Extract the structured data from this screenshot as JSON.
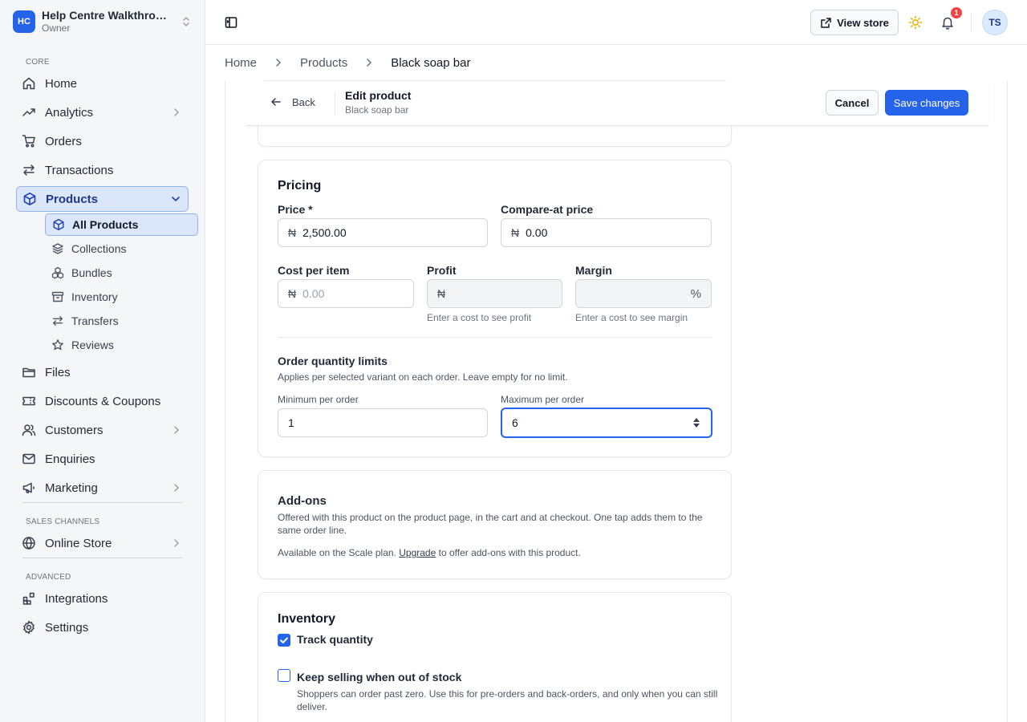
{
  "workspace": {
    "initials": "HC",
    "name": "Help Centre Walkthrough",
    "role": "Owner"
  },
  "sidebar": {
    "core_label": "CORE",
    "home": "Home",
    "analytics": "Analytics",
    "orders": "Orders",
    "transactions": "Transactions",
    "products": "Products",
    "products_sub": {
      "all_products": "All Products",
      "collections": "Collections",
      "bundles": "Bundles",
      "inventory": "Inventory",
      "transfers": "Transfers",
      "reviews": "Reviews"
    },
    "files": "Files",
    "discounts": "Discounts & Coupons",
    "customers": "Customers",
    "enquiries": "Enquiries",
    "marketing": "Marketing",
    "sales_channels_label": "SALES CHANNELS",
    "online_store": "Online Store",
    "advanced_label": "ADVANCED",
    "integrations": "Integrations",
    "settings": "Settings"
  },
  "header": {
    "view_store": "View store",
    "notification_count": "1",
    "user_initials": "TS"
  },
  "breadcrumb": {
    "home": "Home",
    "products": "Products",
    "current": "Black soap bar"
  },
  "editbar": {
    "back": "Back",
    "title": "Edit product",
    "subtitle": "Black soap bar",
    "cancel": "Cancel",
    "save": "Save changes"
  },
  "pricing": {
    "title": "Pricing",
    "currency_symbol": "₦",
    "price_label": "Price *",
    "price_value": "2,500.00",
    "compare_label": "Compare-at price",
    "compare_value": "0.00",
    "cost_label": "Cost per item",
    "cost_placeholder": "0.00",
    "profit_label": "Profit",
    "profit_hint": "Enter a cost to see profit",
    "margin_label": "Margin",
    "margin_unit": "%",
    "margin_hint": "Enter a cost to see margin",
    "limits_title": "Order quantity limits",
    "limits_desc": "Applies per selected variant on each order. Leave empty for no limit.",
    "min_label": "Minimum per order",
    "min_value": "1",
    "max_label": "Maximum per order",
    "max_value": "6"
  },
  "addons": {
    "title": "Add-ons",
    "desc": "Offered with this product on the product page, in the cart and at checkout. One tap adds them to the same order line.",
    "plan_prefix": "Available on the Scale plan.",
    "upgrade": "Upgrade",
    "plan_suffix": "to offer add-ons with this product."
  },
  "inventory": {
    "title": "Inventory",
    "track_label": "Track quantity",
    "track_checked": true,
    "keep_selling_label": "Keep selling when out of stock",
    "keep_selling_checked": false,
    "keep_selling_desc": "Shoppers can order past zero. Use this for pre-orders and back-orders, and only when you can still deliver."
  }
}
